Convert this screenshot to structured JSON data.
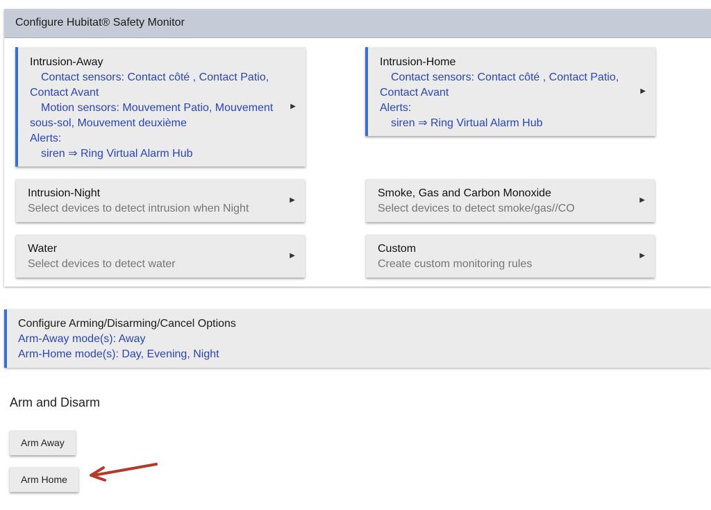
{
  "header": {
    "title": "Configure Hubitat® Safety Monitor"
  },
  "cards": {
    "intrusion_away": {
      "title": "Intrusion-Away",
      "contact_line1": "Contact sensors: Contact côté , Contact Patio,",
      "contact_line2": "Contact Avant",
      "motion_line1": "Motion sensors: Mouvement Patio, Mouvement",
      "motion_line2": "sous-sol, Mouvement deuxième",
      "alerts_label": "Alerts:",
      "alert_item": "siren ⇒ Ring Virtual Alarm Hub"
    },
    "intrusion_home": {
      "title": "Intrusion-Home",
      "contact_line1": "Contact sensors: Contact côté , Contact Patio,",
      "contact_line2": "Contact Avant",
      "alerts_label": "Alerts:",
      "alert_item": "siren ⇒ Ring Virtual Alarm Hub"
    },
    "intrusion_night": {
      "title": "Intrusion-Night",
      "subtitle": "Select devices to detect intrusion when Night"
    },
    "smoke": {
      "title": "Smoke, Gas and Carbon Monoxide",
      "subtitle": "Select devices to detect smoke/gas//CO"
    },
    "water": {
      "title": "Water",
      "subtitle": "Select devices to detect water"
    },
    "custom": {
      "title": "Custom",
      "subtitle": "Create custom monitoring rules"
    },
    "arrow_glyph": "▶"
  },
  "arming": {
    "title": "Configure Arming/Disarming/Cancel Options",
    "arm_away_modes": "Arm-Away mode(s): Away",
    "arm_home_modes": "Arm-Home mode(s): Day, Evening, Night"
  },
  "arm_disarm": {
    "title": "Arm and Disarm",
    "arm_away_label": "Arm Away",
    "arm_home_label": "Arm Home"
  },
  "colors": {
    "accent": "#3a6fd0",
    "link_blue": "#2a45b3",
    "header_bg": "#c5ccd8",
    "card_bg": "#ebebeb",
    "annotation_arrow": "#b23a2a"
  }
}
